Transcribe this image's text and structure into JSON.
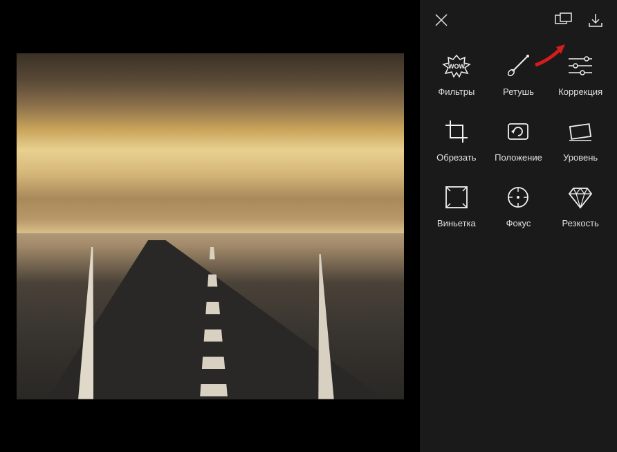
{
  "tools": {
    "filters": {
      "label": "Фильтры"
    },
    "retouch": {
      "label": "Ретушь"
    },
    "correction": {
      "label": "Коррекция"
    },
    "crop": {
      "label": "Обрезать"
    },
    "position": {
      "label": "Положение"
    },
    "level": {
      "label": "Уровень"
    },
    "vignette": {
      "label": "Виньетка"
    },
    "focus": {
      "label": "Фокус"
    },
    "sharpness": {
      "label": "Резкость"
    }
  }
}
